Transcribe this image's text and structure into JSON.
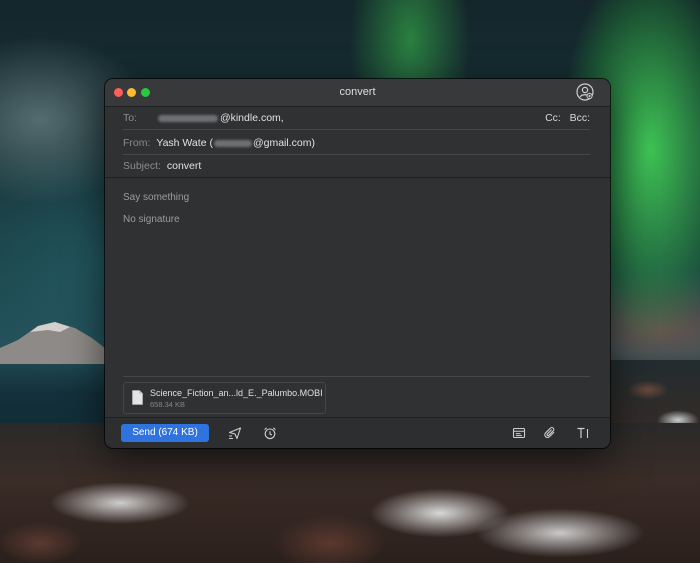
{
  "window": {
    "title": "convert"
  },
  "compose": {
    "to_label": "To:",
    "to_value": "@kindle.com,",
    "cc_bcc": "Cc:   Bcc:",
    "from_label": "From:",
    "from_name": "Yash Wate (",
    "from_email": "@gmail.com)",
    "subject_label": "Subject:",
    "subject_value": "convert",
    "body_placeholder": "Say something",
    "signature": "No signature"
  },
  "attachment": {
    "file_name": "Science_Fiction_an...ld_E._Palumbo.MOBI",
    "file_size": "658.34 KB",
    "icon": "document-icon"
  },
  "footer": {
    "send_label": "Send (674 KB)",
    "icons": [
      "send-later-icon",
      "reminder-clock-icon",
      "template-icon",
      "attachment-clip-icon",
      "text-format-icon"
    ]
  },
  "colors": {
    "accent": "#2f73df",
    "window_bg": "#2f3133",
    "close": "#fe5f57",
    "minimize": "#febc2e",
    "maximize": "#28c840"
  }
}
